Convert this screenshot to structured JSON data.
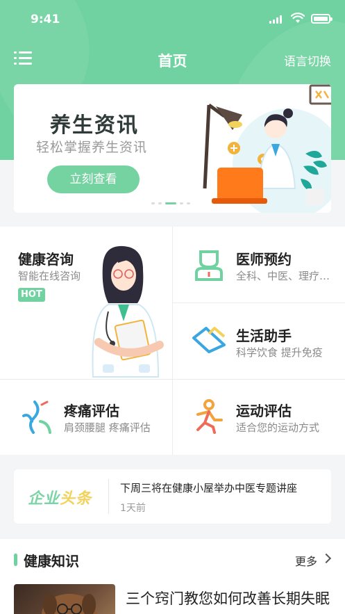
{
  "status_bar": {
    "time": "9:41"
  },
  "nav": {
    "title": "首页",
    "language_switch": "语言切换"
  },
  "banner": {
    "title": "养生资讯",
    "subtitle": "轻松掌握养生资讯",
    "button_label": "立刻查看",
    "active_slide": 3,
    "slide_count": 5
  },
  "services": {
    "consult": {
      "title": "健康咨询",
      "subtitle": "智能在线咨询",
      "badge": "HOT"
    },
    "appointment": {
      "title": "医师预约",
      "subtitle": "全科、中医、理疗…"
    },
    "assistant": {
      "title": "生活助手",
      "subtitle": "科学饮食 提升免疫"
    },
    "pain": {
      "title": "疼痛评估",
      "subtitle": "肩颈腰腿 疼痛评估"
    },
    "sport": {
      "title": "运动评估",
      "subtitle": "适合您的运动方式"
    }
  },
  "news": {
    "logo_part1": "企业",
    "logo_part2": "头条",
    "headline": "下周三将在健康小屋举办中医专题讲座",
    "time_ago": "1天前"
  },
  "knowledge": {
    "section_title": "健康知识",
    "more_label": "更多",
    "articles": [
      {
        "title": "三个窍门教您如何改善长期失眠"
      }
    ]
  },
  "colors": {
    "primary": "#6fd2a0",
    "accent_yellow": "#f2d25a",
    "accent_blue": "#3aa7e0",
    "accent_red": "#ee6b5a"
  }
}
